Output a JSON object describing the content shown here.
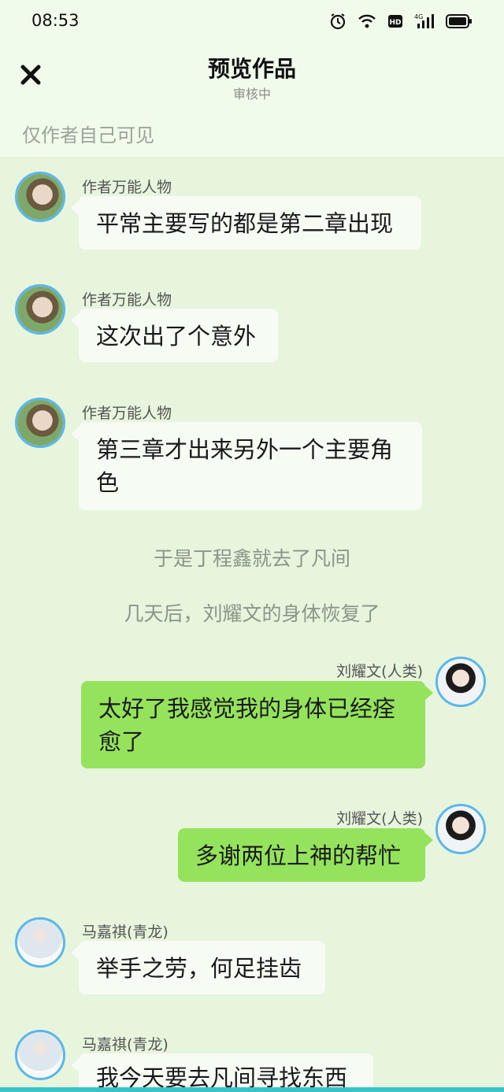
{
  "status_bar": {
    "time": "08:53"
  },
  "header": {
    "title": "预览作品",
    "subtitle": "审核中",
    "note": "仅作者自己可见"
  },
  "messages": [
    {
      "sender": "作者万能人物",
      "text": "平常主要写的都是第二章出现",
      "side": "left"
    },
    {
      "sender": "作者万能人物",
      "text": "这次出了个意外",
      "side": "left"
    },
    {
      "sender": "作者万能人物",
      "text": "第三章才出来另外一个主要角色",
      "side": "left"
    },
    {
      "sender": "刘耀文(人类)",
      "text": "太好了我感觉我的身体已经痊愈了",
      "side": "right"
    },
    {
      "sender": "刘耀文(人类)",
      "text": "多谢两位上神的帮忙",
      "side": "right"
    },
    {
      "sender": "马嘉祺(青龙)",
      "text": "举手之劳，何足挂齿",
      "side": "left"
    },
    {
      "sender": "马嘉祺(青龙)",
      "text": "我今天要去凡间寻找东西",
      "side": "left"
    }
  ],
  "narrations": [
    "于是丁程鑫就去了凡间",
    "几天后，刘耀文的身体恢复了"
  ],
  "colors": {
    "background": "#e6f5dc",
    "bubble_left": "#f6fbf3",
    "bubble_right": "#95e35c",
    "avatar_ring": "#5bb6ea"
  }
}
